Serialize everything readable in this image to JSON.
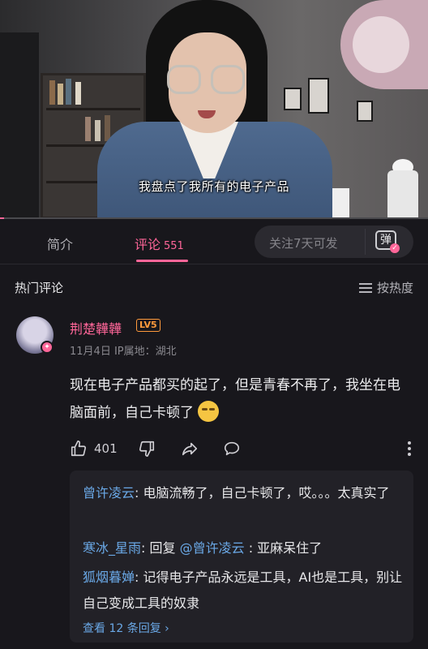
{
  "video": {
    "subtitle": "我盘点了我所有的电子产品",
    "progress": 0.01
  },
  "tabs": {
    "intro_label": "简介",
    "comments_label": "评论",
    "comments_count": "551",
    "danmaku_placeholder": "关注7天可发",
    "danmaku_toggle_glyph": "弹"
  },
  "comments": {
    "section_title": "热门评论",
    "sort_label": "按热度",
    "top": {
      "username": "荆楚韡韡",
      "level": "LV5",
      "meta": "11月4日 IP属地：湖北",
      "text": "现在电子产品都买的起了，但是青春不再了，我坐在电脑面前，自己卡顿了",
      "emoji_icon": "thinking-face-emoji",
      "likes": "401"
    },
    "replies": [
      {
        "username": "曾许凌云",
        "text": "电脑流畅了，自己卡顿了，哎。。。太真实了"
      },
      {
        "username": "寒冰_星雨",
        "prefix": "回复 ",
        "mention": "@曾许凌云",
        "text": " : 亚麻呆住了"
      },
      {
        "username": "狐烟暮婵",
        "text": "记得电子产品永远是工具，AI也是工具，别让自己变成工具的奴隶"
      }
    ],
    "view_all_label": "查看 12 条回复 ›"
  },
  "colors": {
    "accent": "#ff6699",
    "link": "#6aa8e6",
    "background": "#18171c",
    "level_badge": "#ff9a3c"
  }
}
